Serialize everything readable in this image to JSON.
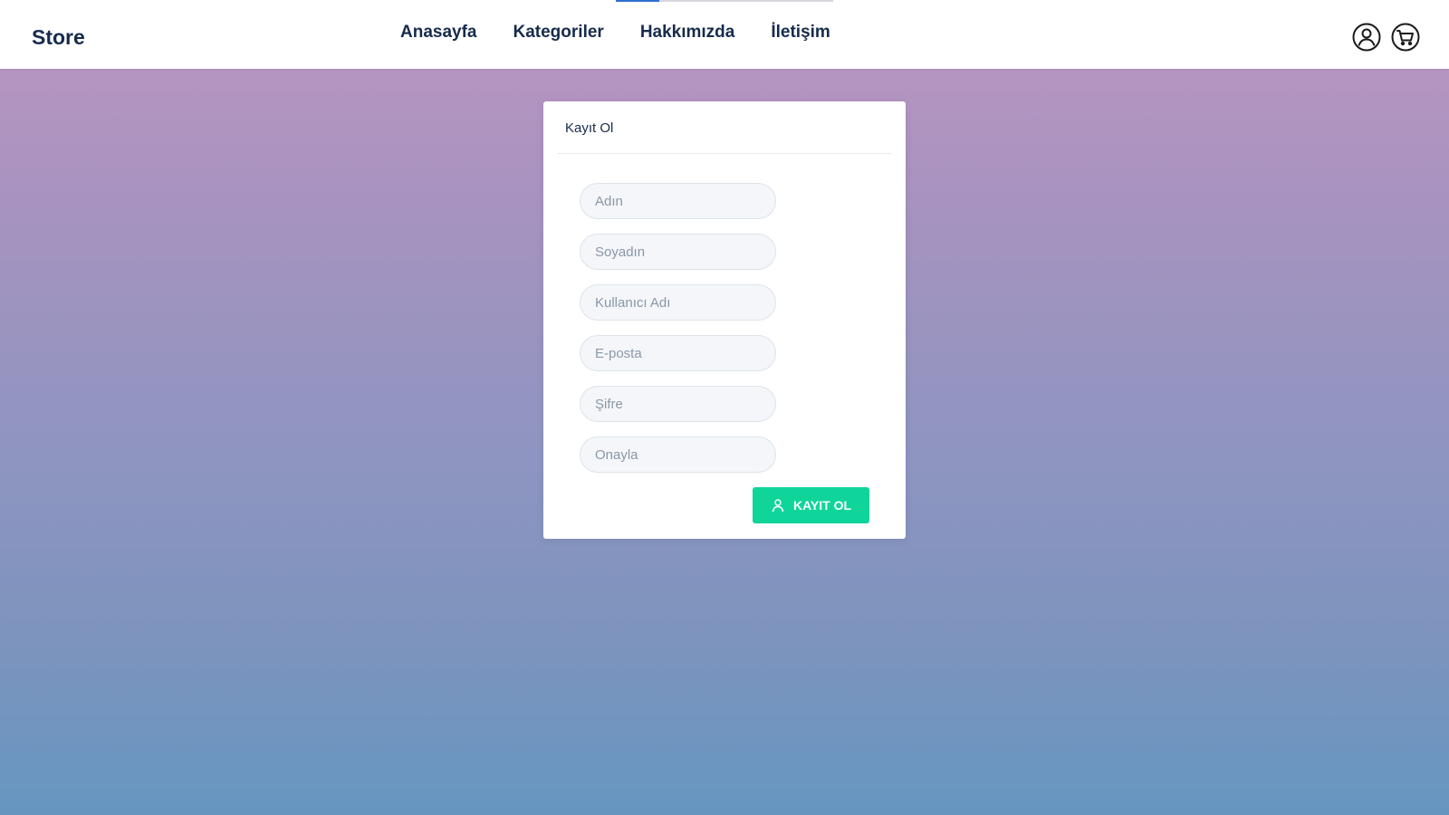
{
  "navbar": {
    "brand": "Store",
    "links": [
      "Anasayfa",
      "Kategoriler",
      "Hakkımızda",
      "İletişim"
    ],
    "icons": [
      "user-icon",
      "cart-icon"
    ],
    "progress": 0.2
  },
  "form": {
    "title": "Kayıt Ol",
    "fields": [
      {
        "placeholder": "Adın",
        "value": ""
      },
      {
        "placeholder": "Soyadın",
        "value": ""
      },
      {
        "placeholder": "Kullanıcı Adı",
        "value": ""
      },
      {
        "placeholder": "E-posta",
        "value": ""
      },
      {
        "placeholder": "Şifre",
        "value": ""
      },
      {
        "placeholder": "Onayla",
        "value": ""
      }
    ],
    "submit_label": "KAYIT OL",
    "submit_icon": "user-icon"
  },
  "colors": {
    "accent": "#0fd59b",
    "text_dark": "#172b4d",
    "progress": "#2f6fcf",
    "bg_top": "#bd94c2",
    "bg_bottom": "#6696c0"
  }
}
